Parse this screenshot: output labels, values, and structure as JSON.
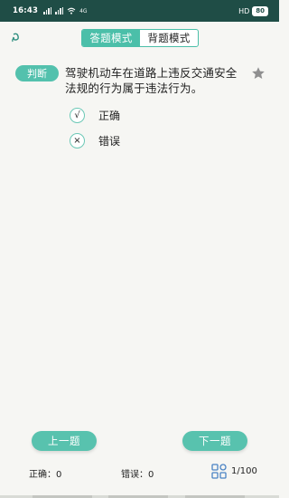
{
  "status_bar": {
    "time": "16:43",
    "network_type": "4G",
    "hd": "HD",
    "battery": "80"
  },
  "header": {
    "tabs": [
      {
        "label": "答题模式",
        "active": true
      },
      {
        "label": "背题模式",
        "active": false
      }
    ]
  },
  "question": {
    "type_tag": "判断",
    "text": "驾驶机动车在道路上违反交通安全法规的行为属于违法行为。",
    "options": [
      {
        "mark": "√",
        "label": "正确"
      },
      {
        "mark": "×",
        "label": "错误"
      }
    ]
  },
  "footer": {
    "prev_label": "上一题",
    "next_label": "下一题",
    "correct": "正确：0",
    "wrong": "错误：0",
    "progress": "1/100"
  },
  "colors": {
    "accent": "#4bbfa9",
    "status_bar": "#1f4d46",
    "background": "#f6f6f3"
  },
  "icons": {
    "back": "swirl-back-icon",
    "favorite": "star-icon",
    "grid": "answer-sheet-grid-icon"
  }
}
